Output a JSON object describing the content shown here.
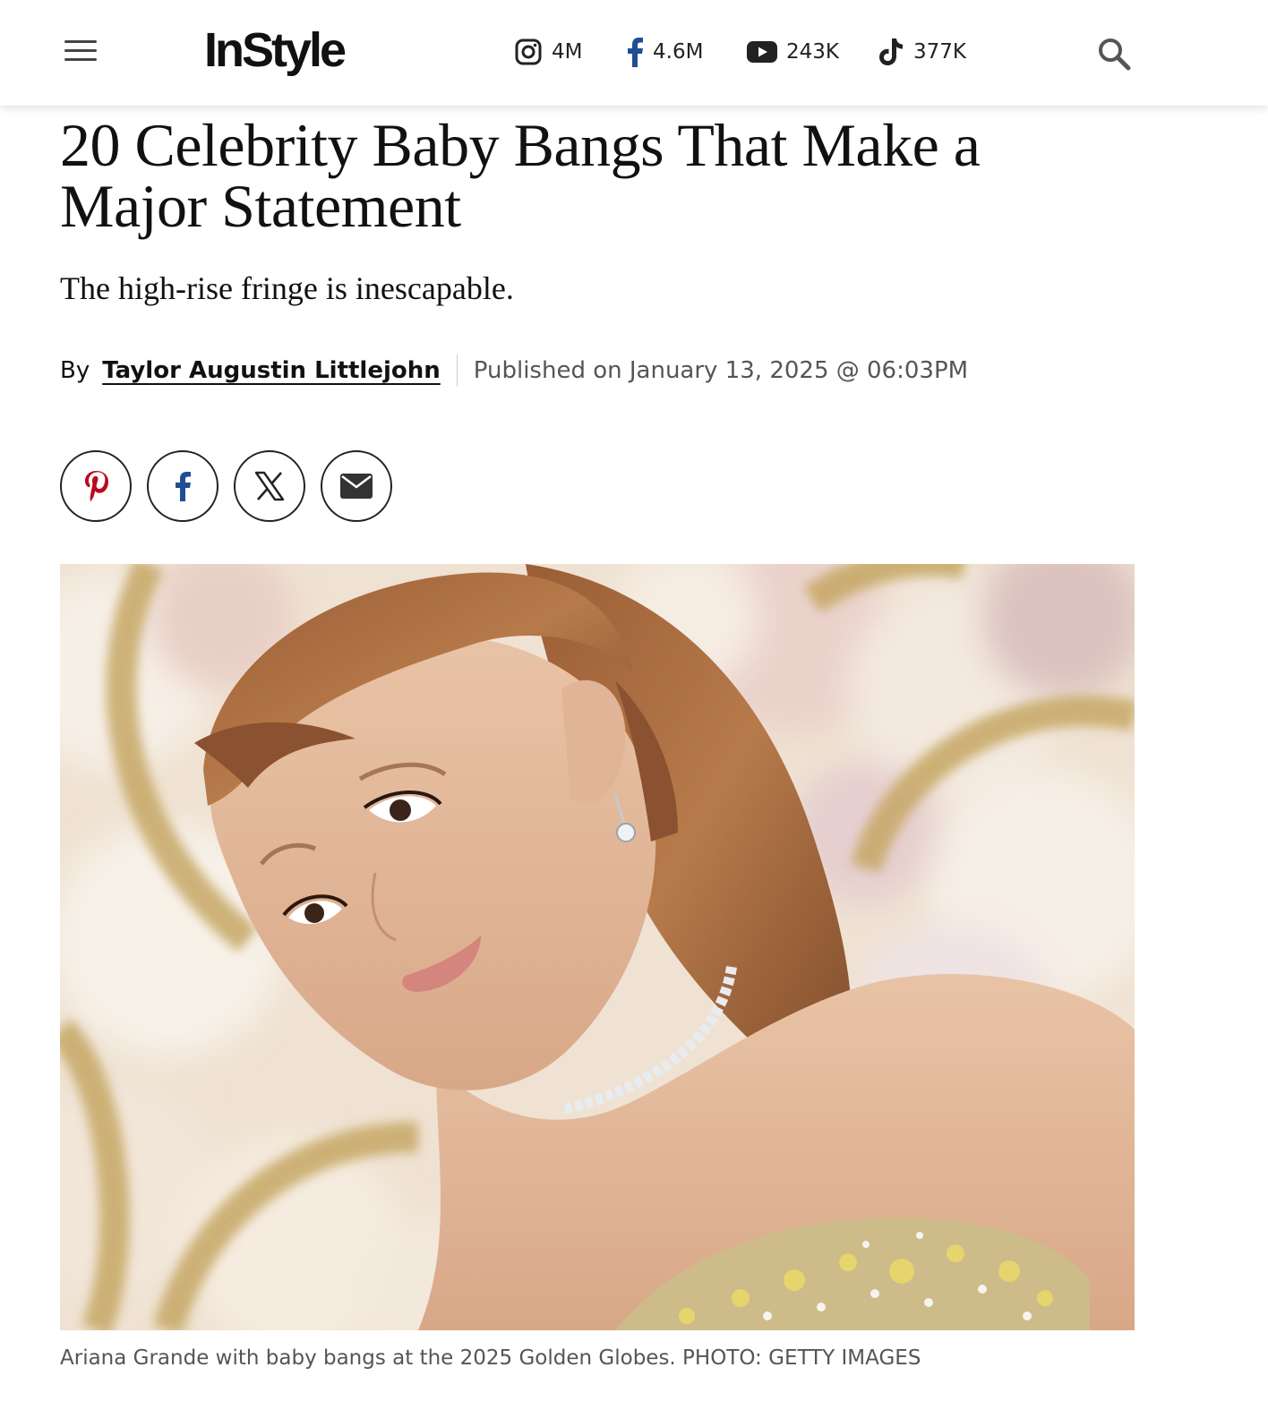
{
  "header": {
    "logo": "InStyle",
    "social": [
      {
        "icon": "instagram-icon",
        "count": "4M"
      },
      {
        "icon": "facebook-icon",
        "count": "4.6M"
      },
      {
        "icon": "youtube-icon",
        "count": "243K"
      },
      {
        "icon": "tiktok-icon",
        "count": "377K"
      }
    ]
  },
  "article": {
    "title": "20 Celebrity Baby Bangs That Make a Major Statement",
    "dek": "The high-rise fringe is inescapable.",
    "byline": {
      "prefix": "By",
      "author": "Taylor Augustin Littlejohn",
      "published": "Published on January 13, 2025 @ 06:03PM"
    },
    "share": [
      "pinterest-icon",
      "facebook-icon",
      "x-icon",
      "email-icon"
    ],
    "caption": "Ariana Grande with baby bangs at the 2025 Golden Globes. PHOTO: GETTY IMAGES"
  },
  "colors": {
    "pinterest": "#bd081c",
    "facebook": "#1f4e96",
    "text": "#111111",
    "muted": "#555555"
  }
}
